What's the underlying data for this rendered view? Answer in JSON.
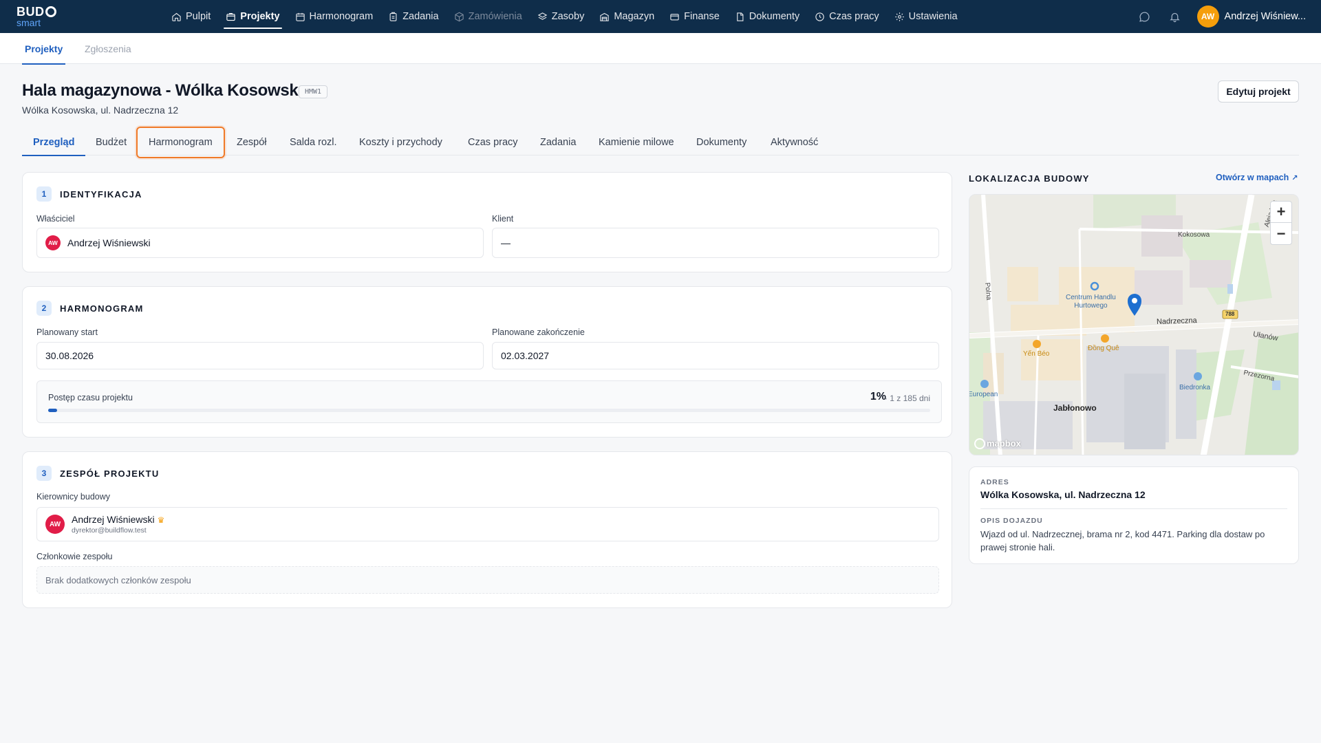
{
  "app": {
    "logo_top": "BUD",
    "logo_bottom": "smart"
  },
  "topnav": {
    "items": [
      {
        "label": "Pulpit",
        "icon": "home-icon"
      },
      {
        "label": "Projekty",
        "icon": "folder-icon"
      },
      {
        "label": "Harmonogram",
        "icon": "calendar-icon"
      },
      {
        "label": "Zadania",
        "icon": "clipboard-icon"
      },
      {
        "label": "Zamówienia",
        "icon": "box-icon"
      },
      {
        "label": "Zasoby",
        "icon": "layers-icon"
      },
      {
        "label": "Magazyn",
        "icon": "warehouse-icon"
      },
      {
        "label": "Finanse",
        "icon": "card-icon"
      },
      {
        "label": "Dokumenty",
        "icon": "document-icon"
      },
      {
        "label": "Czas pracy",
        "icon": "clock-icon"
      },
      {
        "label": "Ustawienia",
        "icon": "gear-icon"
      }
    ],
    "user_initials": "AW",
    "user_name": "Andrzej Wiśniew..."
  },
  "subnav": {
    "tabs": [
      "Projekty",
      "Zgłoszenia"
    ]
  },
  "project": {
    "title": "Hala magazynowa - Wólka Kosowska",
    "code": "HMW1",
    "address": "Wólka Kosowska, ul. Nadrzeczna 12",
    "edit_label": "Edytuj projekt"
  },
  "tabs": [
    "Przegląd",
    "Budżet",
    "Harmonogram",
    "Zespół",
    "Salda rozl.",
    "Koszty i przychody",
    "Czas pracy",
    "Zadania",
    "Kamienie milowe",
    "Dokumenty",
    "Aktywność"
  ],
  "identification": {
    "num": "1",
    "title": "IDENTYFIKACJA",
    "owner_label": "Właściciel",
    "owner_initials": "AW",
    "owner_name": "Andrzej Wiśniewski",
    "client_label": "Klient",
    "client_value": "—"
  },
  "schedule": {
    "num": "2",
    "title": "HARMONOGRAM",
    "start_label": "Planowany start",
    "start_value": "30.08.2026",
    "end_label": "Planowane zakończenie",
    "end_value": "02.03.2027",
    "progress_label": "Postęp czasu projektu",
    "progress_pct": "1%",
    "progress_sub": "· 1 z 185 dni",
    "progress_fraction": 0.01
  },
  "team": {
    "num": "3",
    "title": "ZESPÓŁ PROJEKTU",
    "managers_label": "Kierownicy budowy",
    "manager_initials": "AW",
    "manager_name": "Andrzej Wiśniewski",
    "manager_email": "dyrektor@buildflow.test",
    "members_label": "Członkowie zespołu",
    "members_empty": "Brak dodatkowych członków zespołu"
  },
  "location": {
    "title": "LOKALIZACJA BUDOWY",
    "open_link": "Otwórz w mapach",
    "map_labels": {
      "kokosowa": "Kokosowa",
      "aleja": "Aleja Kra",
      "polna": "Polna",
      "centrum1": "Centrum Handlu",
      "centrum2": "Hurtowego",
      "nadrzeczna": "Nadrzeczna",
      "route": "788",
      "ulanow": "Ułanów",
      "yen": "Yến Béo",
      "dong": "Đồng Quê",
      "przezorna": "Przezorna",
      "biedronka": "Biedronka",
      "european": "European",
      "jablonowo": "Jabłonowo",
      "mapbox": "mapbox"
    },
    "zoom_in": "+",
    "zoom_out": "−",
    "address_label": "ADRES",
    "address_value": "Wólka Kosowska, ul. Nadrzeczna 12",
    "directions_label": "OPIS DOJAZDU",
    "directions_value": "Wjazd od ul. Nadrzecznej, brama nr 2, kod 4471. Parking dla dostaw po prawej stronie hali."
  }
}
